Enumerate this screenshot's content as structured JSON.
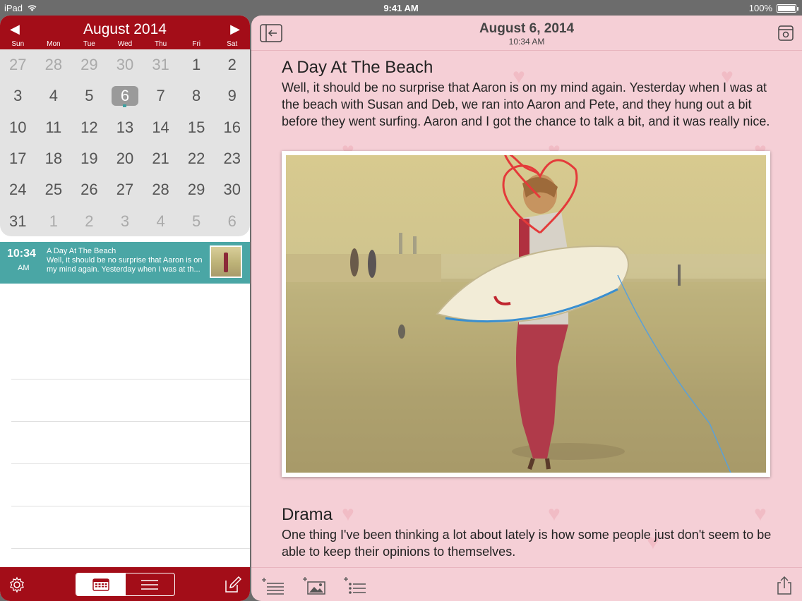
{
  "status": {
    "device": "iPad",
    "time": "9:41 AM",
    "battery": "100%"
  },
  "calendar": {
    "month": "August 2014",
    "weekdays": [
      "Sun",
      "Mon",
      "Tue",
      "Wed",
      "Thu",
      "Fri",
      "Sat"
    ],
    "days": [
      [
        "27",
        "28",
        "29",
        "30",
        "31",
        "1",
        "2"
      ],
      [
        "3",
        "4",
        "5",
        "6",
        "7",
        "8",
        "9"
      ],
      [
        "10",
        "11",
        "12",
        "13",
        "14",
        "15",
        "16"
      ],
      [
        "17",
        "18",
        "19",
        "20",
        "21",
        "22",
        "23"
      ],
      [
        "24",
        "25",
        "26",
        "27",
        "28",
        "29",
        "30"
      ],
      [
        "31",
        "1",
        "2",
        "3",
        "4",
        "5",
        "6"
      ]
    ],
    "selected_day": "6"
  },
  "entry_list": [
    {
      "time": "10:34",
      "ampm": "AM",
      "title": "A Day At The Beach",
      "preview": "Well, it should be no surprise that Aaron is on my mind again.  Yesterday when I was at th..."
    }
  ],
  "entry": {
    "date": "August 6, 2014",
    "time": "10:34 AM",
    "title1": "A Day At The Beach",
    "para1": "Well, it should be no surprise that Aaron is on my mind again.  Yesterday when I was at the beach with Susan and Deb, we ran into Aaron and Pete, and they hung out a bit before they went surfing.  Aaron and I got the chance to talk a bit, and it was really nice.",
    "title2": "Drama",
    "para2": "One thing I've been thinking a lot about lately is how some people just don't seem to be able to keep their opinions to themselves."
  },
  "icons": {
    "back": "sidebar-collapse-icon",
    "settings": "gear-icon",
    "theme": "theme-settings-icon",
    "calendar_view": "calendar-icon",
    "list_view": "list-icon",
    "compose": "compose-icon",
    "add_text": "add-text-icon",
    "add_photo": "add-photo-icon",
    "add_list": "add-list-icon",
    "share": "share-icon"
  },
  "colors": {
    "accent": "#a30d18",
    "entry_highlight": "#4aa6a5",
    "page": "#f5cfd6"
  }
}
